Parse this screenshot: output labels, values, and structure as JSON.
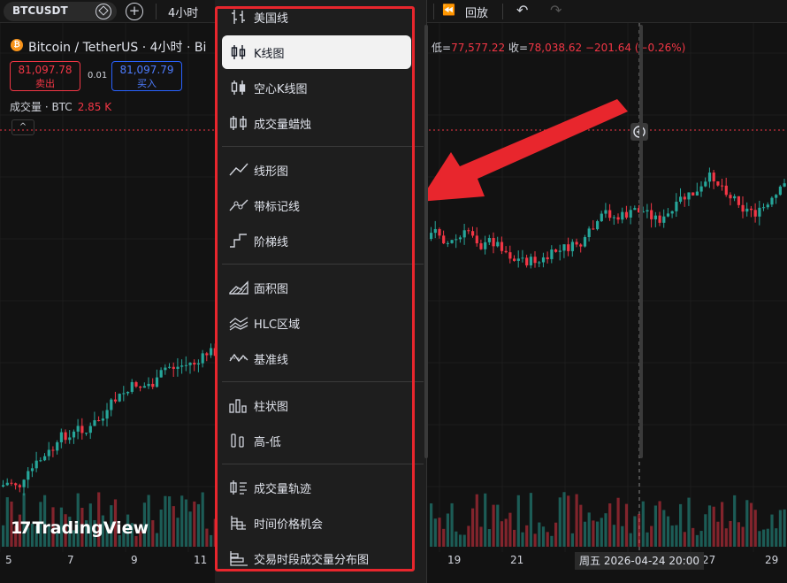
{
  "toolbar": {
    "symbol": "BTCUSDT",
    "add_symbol": "+",
    "interval": "4小时",
    "replay_icon": "⏪",
    "replay_label": "回放",
    "undo_icon": "↶",
    "redo_icon": "↷"
  },
  "legend": {
    "btc_icon_glyph": "₿",
    "title": "Bitcoin / TetherUS · 4小时 · Bi",
    "low_key": "低=",
    "low_value": "77,577.22",
    "close_key": "收=",
    "close_value": "78,038.62",
    "change": "−201.64 (−0.26%)",
    "sell_price": "81,097.78",
    "sell_label": "卖出",
    "spread": "0.01",
    "buy_price": "81,097.79",
    "buy_label": "买入",
    "volume_label": "成交量 · BTC",
    "volume_value": "2.85 K",
    "collapse_icon": "^"
  },
  "time_axis": {
    "labels_left": [
      "5",
      "7",
      "9",
      "11"
    ],
    "labels_right": [
      "19",
      "21",
      "27",
      "29"
    ],
    "crosshair_time": "周五 2026-04-24   20:00"
  },
  "logo": {
    "mark": "17",
    "text": "TradingView"
  },
  "menu": {
    "items": [
      {
        "label": "美国线",
        "icon": "ohlc-bars-icon",
        "active": false
      },
      {
        "label": "K线图",
        "icon": "candles-icon",
        "active": true
      },
      {
        "label": "空心K线图",
        "icon": "hollow-candles-icon",
        "active": false
      },
      {
        "label": "成交量蜡烛",
        "icon": "volume-candles-icon",
        "active": false
      },
      {
        "label": "线形图",
        "icon": "line-icon",
        "active": false
      },
      {
        "label": "带标记线",
        "icon": "line-with-markers-icon",
        "active": false
      },
      {
        "label": "阶梯线",
        "icon": "step-line-icon",
        "active": false
      },
      {
        "label": "面积图",
        "icon": "area-icon",
        "active": false
      },
      {
        "label": "HLC区域",
        "icon": "hlc-area-icon",
        "active": false
      },
      {
        "label": "基准线",
        "icon": "baseline-icon",
        "active": false
      },
      {
        "label": "柱状图",
        "icon": "columns-icon",
        "active": false
      },
      {
        "label": "高-低",
        "icon": "high-low-icon",
        "active": false
      },
      {
        "label": "成交量轨迹",
        "icon": "volume-footprint-icon",
        "active": false
      },
      {
        "label": "时间价格机会",
        "icon": "tpo-icon",
        "active": false
      },
      {
        "label": "交易时段成交量分布图",
        "icon": "session-volume-profile-icon",
        "active": false
      }
    ]
  },
  "colors": {
    "up": "#26a69a",
    "down": "#f23645",
    "accent": "#2962ff",
    "annotation": "#e8262d"
  }
}
